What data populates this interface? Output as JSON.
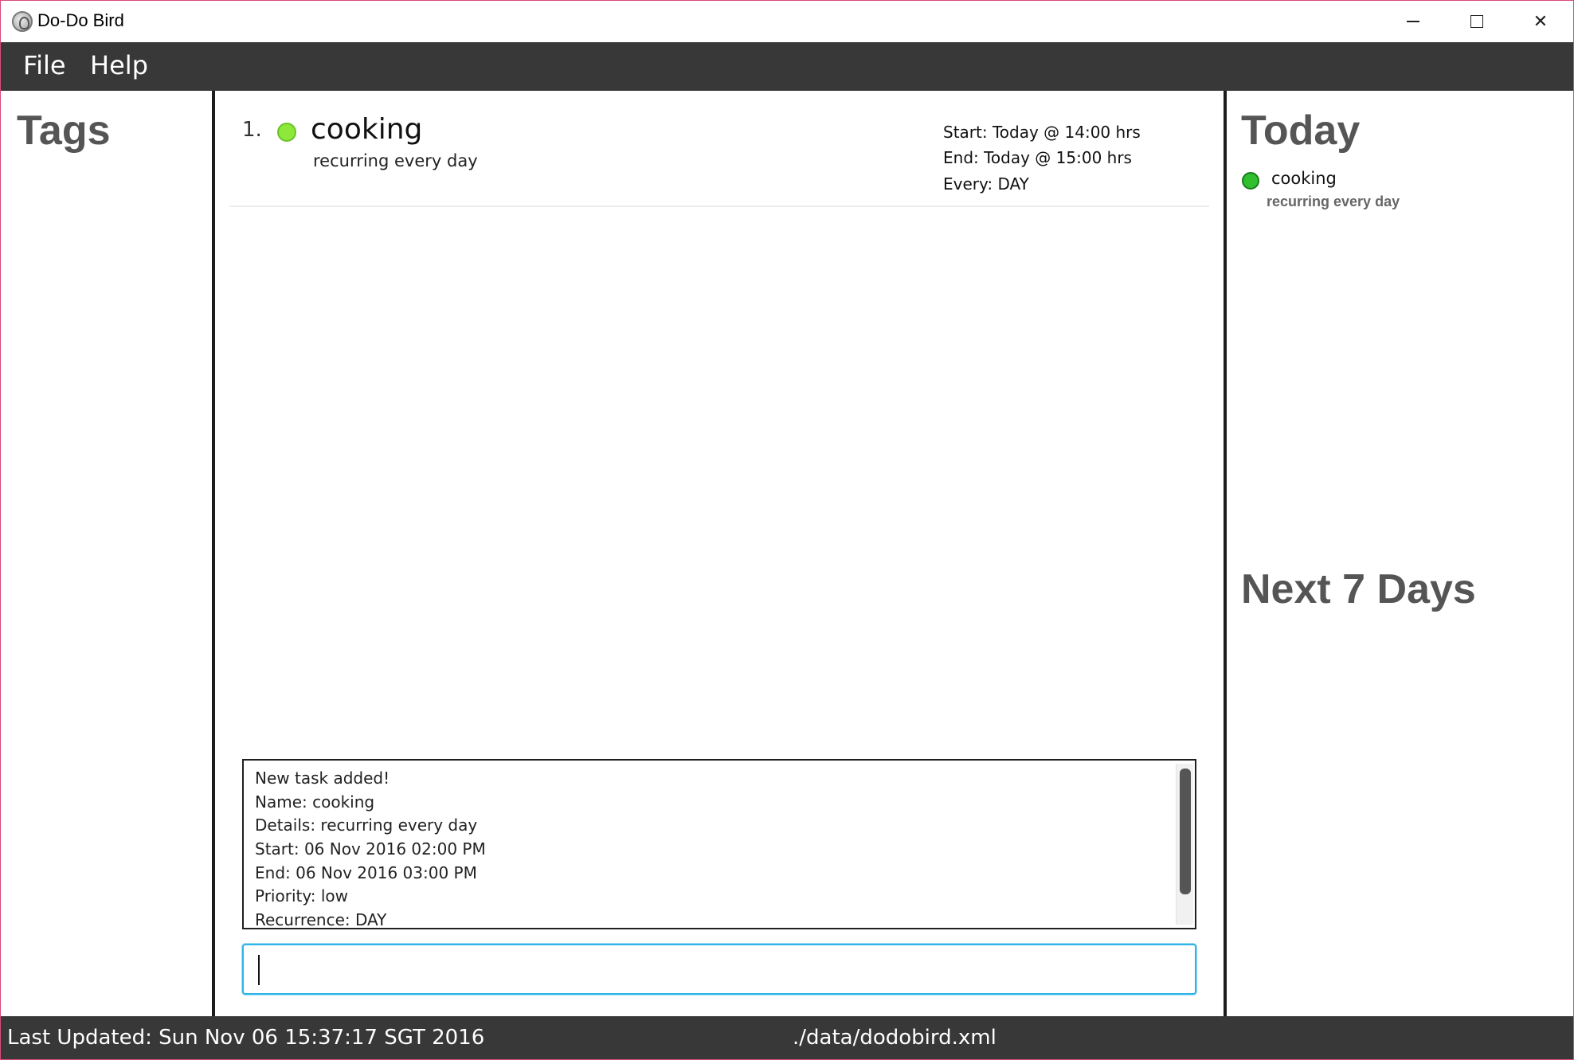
{
  "window": {
    "title": "Do-Do Bird",
    "icon": "dodo-bird-icon",
    "controls": {
      "minimize_icon": "minimize-icon",
      "maximize_icon": "maximize-icon",
      "close_icon": "close-icon",
      "close_glyph": "✕"
    }
  },
  "menu": {
    "items": [
      "File",
      "Help"
    ]
  },
  "tags_panel": {
    "heading": "Tags"
  },
  "task_list": {
    "tasks": [
      {
        "index": "1.",
        "priority_color": "#8ee83a",
        "name": "cooking",
        "details": "recurring every day",
        "start": "Start: Today @ 14:00 hrs",
        "end": "End: Today @ 15:00 hrs",
        "every": "Every: DAY"
      }
    ]
  },
  "result_display": {
    "lines": [
      "New task added!",
      "Name: cooking",
      "Details: recurring every day",
      "Start: 06 Nov 2016 02:00 PM",
      "End: 06 Nov 2016 03:00 PM",
      "Priority: low",
      "Recurrence: DAY"
    ]
  },
  "command_box": {
    "value": "",
    "accent_color": "#30b4e6"
  },
  "today_panel": {
    "heading": "Today",
    "items": [
      {
        "name": "cooking",
        "details": "recurring every day",
        "dot_color": "#2fbf2f"
      }
    ]
  },
  "next7_panel": {
    "heading": "Next 7 Days",
    "items": []
  },
  "status_bar": {
    "last_updated": "Last Updated: Sun Nov 06 15:37:17 SGT 2016",
    "save_location": "./data/dodobird.xml"
  }
}
